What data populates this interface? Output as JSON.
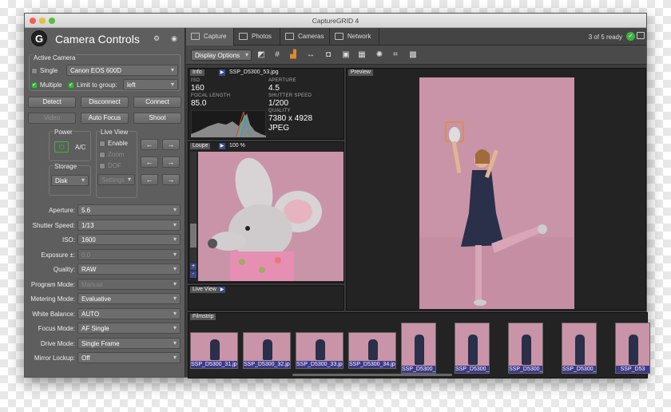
{
  "window": {
    "title": "CaptureGRID 4"
  },
  "panel": {
    "title": "Camera Controls",
    "active_camera": {
      "legend": "Active Camera",
      "single_label": "Single",
      "camera_value": "Canon EOS 600D",
      "multiple_label": "Multiple",
      "limit_label": "Limit to group:",
      "group_value": "left"
    },
    "buttons": {
      "detect": "Detect",
      "disconnect": "Disconnect",
      "connect": "Connect",
      "video": "Video",
      "autofocus": "Auto Focus",
      "shoot": "Shoot"
    },
    "power": {
      "legend": "Power",
      "value": "A/C"
    },
    "storage": {
      "legend": "Storage",
      "value": "Disk"
    },
    "liveview": {
      "legend": "Live View",
      "enable": "Enable",
      "zoom": "Zoom",
      "dof": "DOF",
      "settings": "Settings"
    },
    "arrows": {
      "left": "←",
      "right": "→"
    },
    "props": [
      {
        "label": "Aperture:",
        "value": "5.6",
        "disabled": false
      },
      {
        "label": "Shutter Speed:",
        "value": "1/13",
        "disabled": false
      },
      {
        "label": "ISO:",
        "value": "1600",
        "disabled": false
      },
      {
        "label": "Exposure ±:",
        "value": "0.0",
        "disabled": true
      },
      {
        "label": "Quality:",
        "value": "RAW",
        "disabled": false
      },
      {
        "label": "Program Mode:",
        "value": "Manual",
        "disabled": true
      },
      {
        "label": "Metering Mode:",
        "value": "Evaluative",
        "disabled": false
      },
      {
        "label": "White Balance:",
        "value": "AUTO",
        "disabled": false
      },
      {
        "label": "Focus Mode:",
        "value": "AF Single",
        "disabled": false
      },
      {
        "label": "Drive Mode:",
        "value": "Single Frame",
        "disabled": false
      },
      {
        "label": "Mirror Lockup:",
        "value": "Off",
        "disabled": false
      }
    ]
  },
  "tabs": [
    "Capture",
    "Photos",
    "Cameras",
    "Network"
  ],
  "status": {
    "ready": "3 of 5 ready"
  },
  "toolbar": {
    "display_options": "Display Options"
  },
  "info": {
    "tag": "Info",
    "file": "SSP_D5300_53.jpg",
    "iso_label": "ISO",
    "iso": "160",
    "aperture_label": "APERTURE",
    "aperture": "4.5",
    "focal_label": "FOCAL LENGTH",
    "focal": "85.0",
    "shutter_label": "SHUTTER SPEED",
    "shutter": "1/200",
    "quality_label": "QUALITY",
    "dims": "7380 x 4928",
    "format": "JPEG"
  },
  "loupe": {
    "tag": "Loupe",
    "zoom": "100 %"
  },
  "liveview_pane": {
    "tag": "Live View"
  },
  "preview": {
    "tag": "Preview"
  },
  "filmstrip": {
    "tag": "Filmstrip",
    "items": [
      "SSP_D5300_31.jpg",
      "SSP_D5300_32.jpg",
      "SSP_D5300_33.jpg",
      "SSP_D5300_34.jpg",
      "SSP_D5300_",
      "SSP_D5300_",
      "SSP_D5300_",
      "SSP_D5300_",
      "SSP_D53"
    ]
  },
  "colors": {
    "accent": "#3fb43f",
    "selection": "#3d3a8a",
    "backdrop": "#c994a8"
  }
}
